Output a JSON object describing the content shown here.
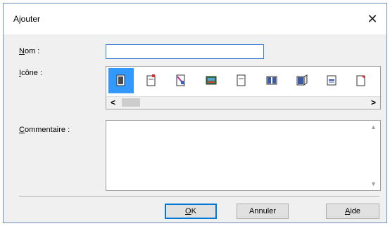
{
  "dialog": {
    "title": "Ajouter",
    "close_glyph": "✕"
  },
  "fields": {
    "name_label_access": "N",
    "name_label_rest": "om :",
    "name_value": "",
    "icon_label_access": "I",
    "icon_label_rest": "cône :",
    "comment_label_access": "C",
    "comment_label_rest": "ommentaire :",
    "comment_value": ""
  },
  "icons": [
    {
      "name": "document-icon",
      "selected": true
    },
    {
      "name": "document-red-tab-icon",
      "selected": false
    },
    {
      "name": "document-diagonal-icon",
      "selected": false
    },
    {
      "name": "photo-icon",
      "selected": false
    },
    {
      "name": "document-plain-icon",
      "selected": false
    },
    {
      "name": "book-icon",
      "selected": false
    },
    {
      "name": "document-fold-icon",
      "selected": false
    },
    {
      "name": "document-text-icon",
      "selected": false
    },
    {
      "name": "document-red-corner-icon",
      "selected": false
    }
  ],
  "scroll": {
    "left_glyph": "<",
    "right_glyph": ">",
    "up_glyph": "▲",
    "down_glyph": "▼"
  },
  "buttons": {
    "ok_access": "O",
    "ok_rest": "K",
    "cancel": "Annuler",
    "help_access": "A",
    "help_rest": "ide"
  }
}
